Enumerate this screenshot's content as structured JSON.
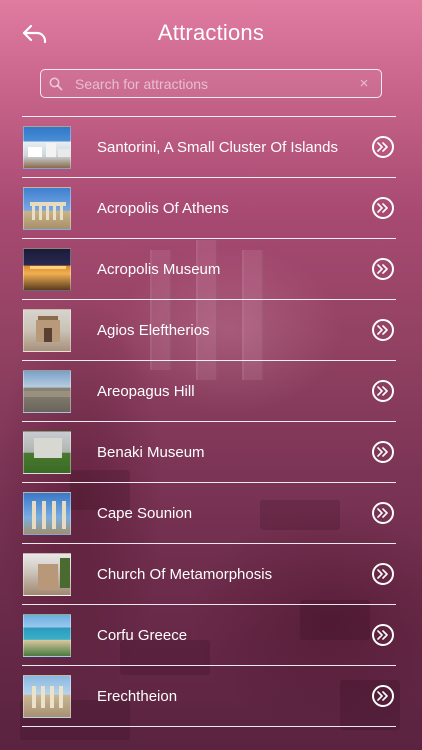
{
  "header": {
    "title": "Attractions",
    "back_icon": "back-arrow-icon"
  },
  "search": {
    "placeholder": "Search for attractions",
    "value": "",
    "search_icon": "magnifier-icon",
    "clear_glyph": "×"
  },
  "attractions": [
    {
      "name": "Santorini, A Small Cluster Of Islands",
      "thumb_icon": "santorini-photo"
    },
    {
      "name": "Acropolis Of Athens",
      "thumb_icon": "parthenon-photo"
    },
    {
      "name": "Acropolis Museum",
      "thumb_icon": "museum-night-photo"
    },
    {
      "name": "Agios Eleftherios",
      "thumb_icon": "church-photo"
    },
    {
      "name": "Areopagus Hill",
      "thumb_icon": "hill-photo"
    },
    {
      "name": "Benaki Museum",
      "thumb_icon": "benaki-photo"
    },
    {
      "name": "Cape Sounion",
      "thumb_icon": "temple-columns-photo"
    },
    {
      "name": "Church Of Metamorphosis",
      "thumb_icon": "stone-church-photo"
    },
    {
      "name": "Corfu Greece",
      "thumb_icon": "coast-photo"
    },
    {
      "name": "Erechtheion",
      "thumb_icon": "caryatids-photo"
    }
  ],
  "colors": {
    "header_top": "#e07ca0",
    "background_bottom": "#5a2340",
    "divider": "#ffffff"
  }
}
